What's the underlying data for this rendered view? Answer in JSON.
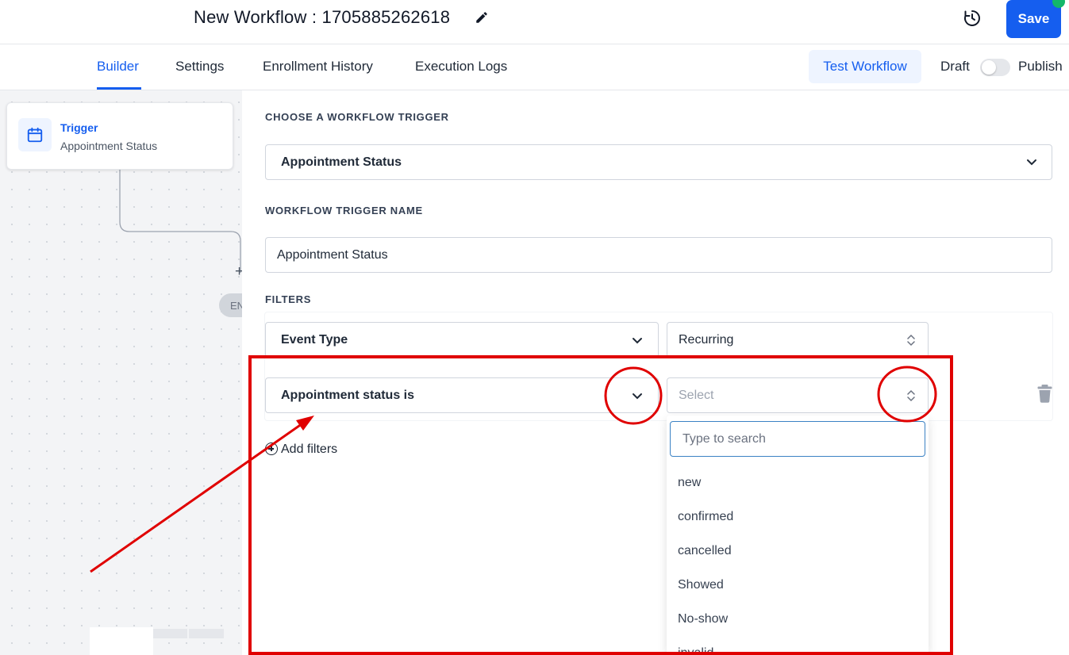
{
  "header": {
    "workflow_title": "New Workflow : 1705885262618",
    "save_label": "Save"
  },
  "tabs": [
    {
      "label": "Builder",
      "active": true
    },
    {
      "label": "Settings",
      "active": false
    },
    {
      "label": "Enrollment History",
      "active": false
    },
    {
      "label": "Execution Logs",
      "active": false
    }
  ],
  "toolbar": {
    "test_label": "Test Workflow",
    "draft_label": "Draft",
    "publish_label": "Publish",
    "published": false
  },
  "canvas": {
    "trigger_title": "Trigger",
    "trigger_subtitle": "Appointment Status",
    "end_label": "EN"
  },
  "panel": {
    "choose_trigger_label": "CHOOSE A WORKFLOW TRIGGER",
    "trigger_value": "Appointment Status",
    "trigger_name_label": "WORKFLOW TRIGGER NAME",
    "trigger_name_value": "Appointment Status",
    "filters_label": "FILTERS",
    "filters": [
      {
        "field": "Event Type",
        "value": "Recurring"
      },
      {
        "field": "Appointment status is",
        "value": "",
        "placeholder": "Select"
      }
    ],
    "add_filters_label": "Add filters"
  },
  "dropdown": {
    "search_placeholder": "Type to search",
    "options": [
      "new",
      "confirmed",
      "cancelled",
      "Showed",
      "No-show",
      "invalid"
    ]
  },
  "colors": {
    "primary": "#155eef",
    "annotation": "#e00000",
    "status_dot": "#12b76a"
  }
}
